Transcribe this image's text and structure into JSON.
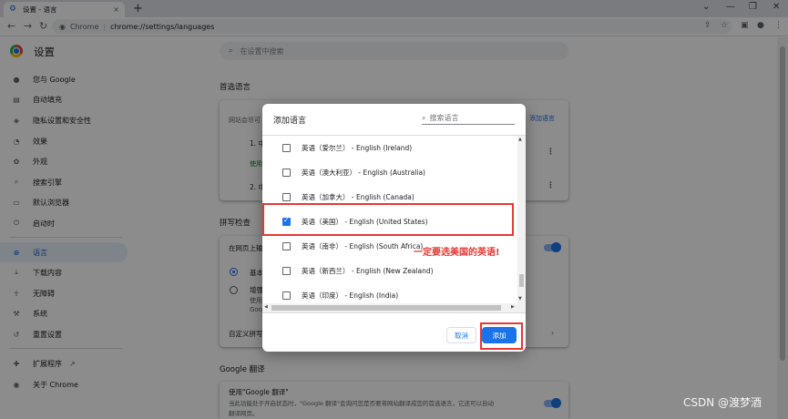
{
  "browser": {
    "tab_title": "设置 - 语言",
    "tab_close": "×",
    "new_tab": "+",
    "omnibox_label": "Chrome",
    "url": "chrome://settings/languages",
    "window_controls": [
      "⌄",
      "—",
      "❐",
      "✕"
    ]
  },
  "settings": {
    "title": "设置",
    "search_placeholder": "在设置中搜索"
  },
  "sidebar": {
    "items": [
      {
        "label": "您与 Google",
        "icon": "person-icon"
      },
      {
        "label": "自动填充",
        "icon": "clipboard-icon"
      },
      {
        "label": "隐私设置和安全性",
        "icon": "shield-icon"
      },
      {
        "label": "效果",
        "icon": "speedometer-icon"
      },
      {
        "label": "外观",
        "icon": "palette-icon"
      },
      {
        "label": "搜索引擎",
        "icon": "search-icon"
      },
      {
        "label": "默认浏览器",
        "icon": "browser-icon"
      },
      {
        "label": "启动时",
        "icon": "power-icon"
      },
      {
        "label": "语言",
        "icon": "globe-icon"
      },
      {
        "label": "下载内容",
        "icon": "download-icon"
      },
      {
        "label": "无障碍",
        "icon": "accessibility-icon"
      },
      {
        "label": "系统",
        "icon": "wrench-icon"
      },
      {
        "label": "重置设置",
        "icon": "reset-icon"
      },
      {
        "label": "扩展程序",
        "icon": "puzzle-icon"
      },
      {
        "label": "关于 Chrome",
        "icon": "chrome-icon"
      }
    ]
  },
  "main": {
    "preferred_title": "首选语言",
    "preferred_desc": "网站会尽可",
    "add_languages": "添加语言",
    "lang1": "1. 中",
    "lang1_note": "使用",
    "lang2": "2. 中",
    "spell_title": "拼写检查",
    "spell_row": "在网页上输",
    "basic": "基本",
    "enhanced": "增强",
    "enhanced_desc1": "使用",
    "enhanced_desc2": "Goo",
    "custom_spell": "自定义拼写",
    "translate_title": "Google 翻译",
    "translate_use": "使用\"Google 翻译\"",
    "translate_desc1": "当此功能处于开启状态时，\"Google 翻译\"会询问您是否要将网站翻译成您的首选语言，它还可以自动",
    "translate_desc2": "翻译网页。"
  },
  "dialog": {
    "title": "添加语言",
    "search_placeholder": "搜索语言",
    "languages": [
      {
        "label": "英语（爱尔兰） - English (Ireland)",
        "checked": false
      },
      {
        "label": "英语（澳大利亚） - English (Australia)",
        "checked": false
      },
      {
        "label": "英语（加拿大） - English (Canada)",
        "checked": false
      },
      {
        "label": "英语（美国） - English (United States)",
        "checked": true
      },
      {
        "label": "英语（南非） - English (South Africa)",
        "checked": false
      },
      {
        "label": "英语（新西兰） - English (New Zealand)",
        "checked": false
      },
      {
        "label": "英语（印度） - English (India)",
        "checked": false
      }
    ],
    "cancel": "取消",
    "add": "添加"
  },
  "annotation": {
    "note": "一定要选美国的英语!",
    "color": "#e53935"
  },
  "watermark": "CSDN @渡梦酒",
  "colors": {
    "accent": "#1a73e8",
    "annotation_red": "#e53935"
  }
}
